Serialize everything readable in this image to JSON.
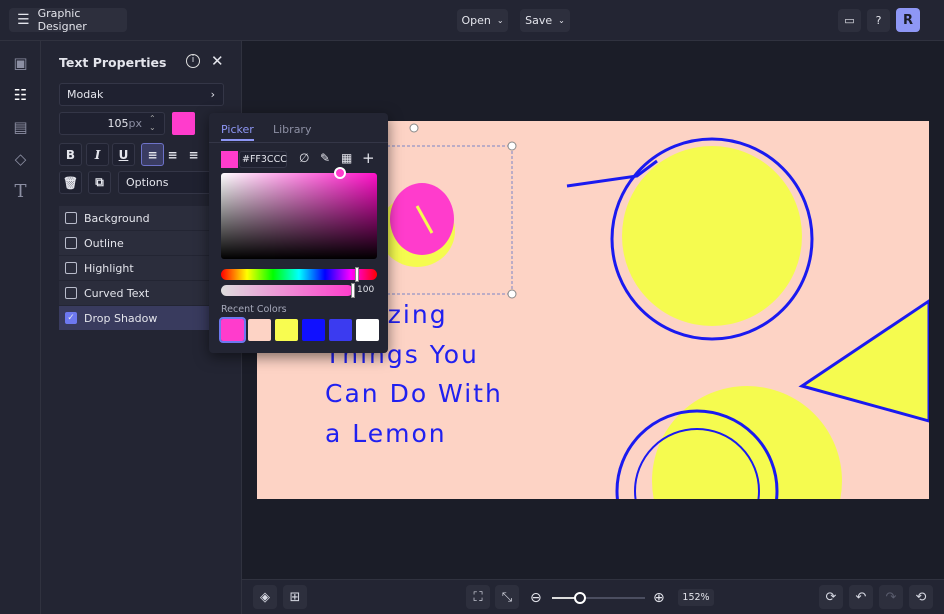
{
  "app": {
    "title": "Graphic Designer",
    "menu_icon": "hamburger-icon"
  },
  "topbar": {
    "open_label": "Open",
    "save_label": "Save",
    "avatar_initial": "R"
  },
  "panel": {
    "title": "Text Properties",
    "font": "Modak",
    "font_size": "105",
    "font_unit": "px",
    "text_color": "#FF3CCC",
    "options_label": "Options",
    "effects": [
      {
        "label": "Background",
        "checked": false
      },
      {
        "label": "Outline",
        "checked": false
      },
      {
        "label": "Highlight",
        "checked": false
      },
      {
        "label": "Curved Text",
        "checked": false
      },
      {
        "label": "Drop Shadow",
        "checked": true
      }
    ]
  },
  "picker": {
    "tabs": [
      "Picker",
      "Library"
    ],
    "active_tab": "Picker",
    "hex": "#FF3CCC",
    "opacity": "100",
    "recent_label": "Recent Colors",
    "recent_colors": [
      "#FF3CCC",
      "#FDD3C5",
      "#F8FC50",
      "#1010FF",
      "#3B3BF0",
      "#FFFFFF"
    ]
  },
  "canvas": {
    "headline": [
      "Amazing",
      "Things You",
      "Can Do With",
      "a Lemon"
    ],
    "background": "#FDD3C5",
    "text_color": "#2020F0",
    "lemon_color": "#F5FB4F"
  },
  "bottombar": {
    "zoom": "152%",
    "zoom_level": 0.3
  }
}
